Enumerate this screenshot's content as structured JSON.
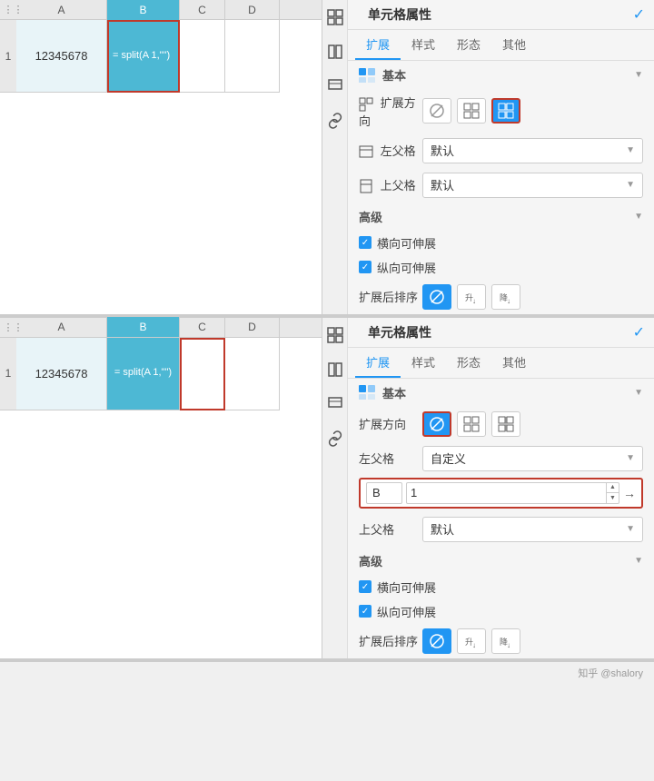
{
  "panel1": {
    "spreadsheet": {
      "cols": [
        "",
        "A",
        "B",
        "C",
        "D"
      ],
      "row_num": "1",
      "cell_a_value": "12345678",
      "cell_b_formula": "=\nsplit(A\n1,\"\")",
      "tabs_dots": "⋮⋮⋮"
    },
    "props": {
      "title": "单元格属性",
      "check_icon": "✓",
      "tabs": [
        "扩展",
        "样式",
        "形态",
        "其他"
      ],
      "active_tab": "扩展",
      "sections": {
        "basic": "基本",
        "advanced": "高级"
      },
      "expand_direction_label": "扩展方向",
      "left_parent_label": "左父格",
      "top_parent_label": "上父格",
      "left_parent_value": "默认",
      "top_parent_value": "默认",
      "dir_none": "⊘",
      "dir_horizontal": "⊞",
      "dir_vertical": "⊞",
      "active_direction": "vertical",
      "checkbox_horizontal": "横向可伸展",
      "checkbox_vertical": "纵向可伸展",
      "sort_label": "扩展后排序",
      "sort_none": "⊘",
      "sort_asc": "升↓",
      "sort_desc": "降↓"
    }
  },
  "panel2": {
    "spreadsheet": {
      "row_num": "1",
      "cell_a_value": "12345678",
      "cell_b_formula": "=\nsplit(A\n1,\"\")"
    },
    "props": {
      "title": "单元格属性",
      "check_icon": "✓",
      "tabs": [
        "扩展",
        "样式",
        "形态",
        "其他"
      ],
      "active_tab": "扩展",
      "expand_direction_label": "扩展方向",
      "left_parent_label": "左父格",
      "top_parent_label": "上父格",
      "left_parent_value": "自定义",
      "top_parent_value": "默认",
      "left_input_col": "B",
      "left_input_row": "1",
      "active_direction": "none",
      "checkbox_horizontal": "横向可伸展",
      "checkbox_vertical": "纵向可伸展",
      "sort_label": "扩展后排序"
    }
  },
  "icons": {
    "expand": "⊞",
    "style": "🖌",
    "link": "🔗",
    "grid": "⊞",
    "panel1_side": [
      "⊟",
      "⊟",
      "⊟",
      "🔗"
    ],
    "panel2_side": [
      "⊟",
      "⊟",
      "⊟",
      "🔗"
    ]
  }
}
